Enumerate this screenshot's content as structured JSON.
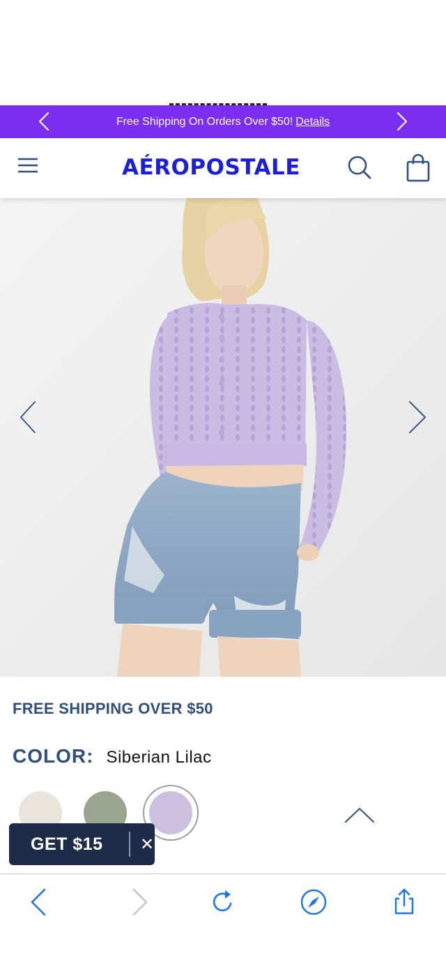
{
  "promo": {
    "message": "Free Shipping On Orders Over $50!",
    "details_link": "Details",
    "prev_icon": "chevron-left-icon",
    "next_icon": "chevron-right-icon",
    "background_color": "#7b2ef0"
  },
  "header": {
    "menu_icon": "hamburger-menu-icon",
    "logo_text": "AÉROPOSTALE",
    "logo_color": "#1b1fd6",
    "search_icon": "search-icon",
    "bag_icon": "shopping-bag-icon"
  },
  "product_image": {
    "prev_icon": "chevron-left-icon",
    "next_icon": "chevron-right-icon"
  },
  "shipping": {
    "text": "FREE SHIPPING OVER $50"
  },
  "color": {
    "label": "COLOR:",
    "selected_value": "Siberian Lilac",
    "swatches": [
      {
        "color": "#e9e5dc",
        "selected": false
      },
      {
        "color": "#9aa48e",
        "selected": false
      },
      {
        "color": "#cdbfe0",
        "selected": true
      }
    ]
  },
  "scroll_top": {
    "icon": "chevron-up-icon"
  },
  "offer_popup": {
    "label": "GET $15",
    "close_label": "✕"
  },
  "browser_toolbar": {
    "back_icon": "back-arrow-icon",
    "forward_icon": "forward-arrow-icon",
    "reload_icon": "reload-icon",
    "compass_icon": "compass-icon",
    "share_icon": "share-icon",
    "accent_color": "#1a73e8"
  }
}
